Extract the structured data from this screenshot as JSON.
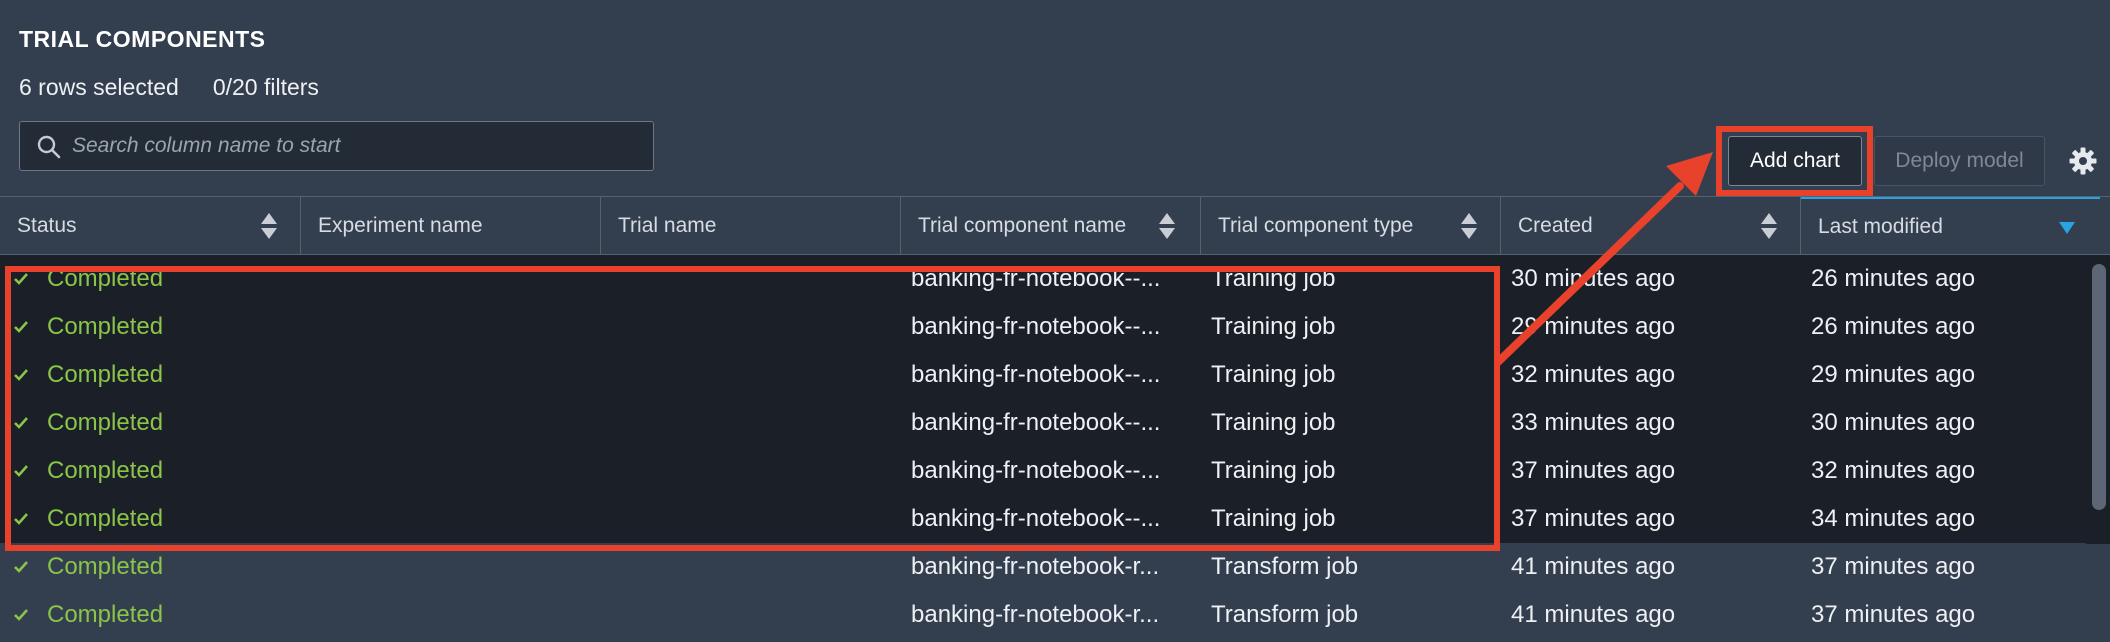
{
  "header": {
    "title": "TRIAL COMPONENTS",
    "rows_selected": "6 rows selected",
    "filters": "0/20 filters"
  },
  "search": {
    "placeholder": "Search column name to start",
    "value": ""
  },
  "toolbar": {
    "add_chart_label": "Add chart",
    "deploy_model_label": "Deploy model"
  },
  "columns": [
    "Status",
    "Experiment name",
    "Trial name",
    "Trial component name",
    "Trial component type",
    "Created",
    "Last modified"
  ],
  "rows": [
    {
      "status": "Completed",
      "experiment": "",
      "trial": "",
      "component": "banking-fr-notebook--...",
      "type": "Training job",
      "created": "30 minutes ago",
      "modified": "26 minutes ago",
      "selected": true
    },
    {
      "status": "Completed",
      "experiment": "",
      "trial": "",
      "component": "banking-fr-notebook--...",
      "type": "Training job",
      "created": "29 minutes ago",
      "modified": "26 minutes ago",
      "selected": true
    },
    {
      "status": "Completed",
      "experiment": "",
      "trial": "",
      "component": "banking-fr-notebook--...",
      "type": "Training job",
      "created": "32 minutes ago",
      "modified": "29 minutes ago",
      "selected": true
    },
    {
      "status": "Completed",
      "experiment": "",
      "trial": "",
      "component": "banking-fr-notebook--...",
      "type": "Training job",
      "created": "33 minutes ago",
      "modified": "30 minutes ago",
      "selected": true
    },
    {
      "status": "Completed",
      "experiment": "",
      "trial": "",
      "component": "banking-fr-notebook--...",
      "type": "Training job",
      "created": "37 minutes ago",
      "modified": "32 minutes ago",
      "selected": true
    },
    {
      "status": "Completed",
      "experiment": "",
      "trial": "",
      "component": "banking-fr-notebook--...",
      "type": "Training job",
      "created": "37 minutes ago",
      "modified": "34 minutes ago",
      "selected": true
    },
    {
      "status": "Completed",
      "experiment": "",
      "trial": "",
      "component": "banking-fr-notebook-r...",
      "type": "Transform job",
      "created": "41 minutes ago",
      "modified": "37 minutes ago",
      "selected": false
    },
    {
      "status": "Completed",
      "experiment": "",
      "trial": "",
      "component": "banking-fr-notebook-r...",
      "type": "Transform job",
      "created": "41 minutes ago",
      "modified": "37 minutes ago",
      "selected": false
    }
  ],
  "icons": {
    "search": "search-icon",
    "settings": "gear-icon",
    "sort": "sort-icon",
    "sort_desc": "sort-descending-icon",
    "status": "check-icon"
  },
  "colors": {
    "background": "#333e4f",
    "selected_row": "#1a1f28",
    "status_completed": "#8ac44a",
    "annotation": "#e8412c",
    "sort_active": "#2aa3e0"
  }
}
